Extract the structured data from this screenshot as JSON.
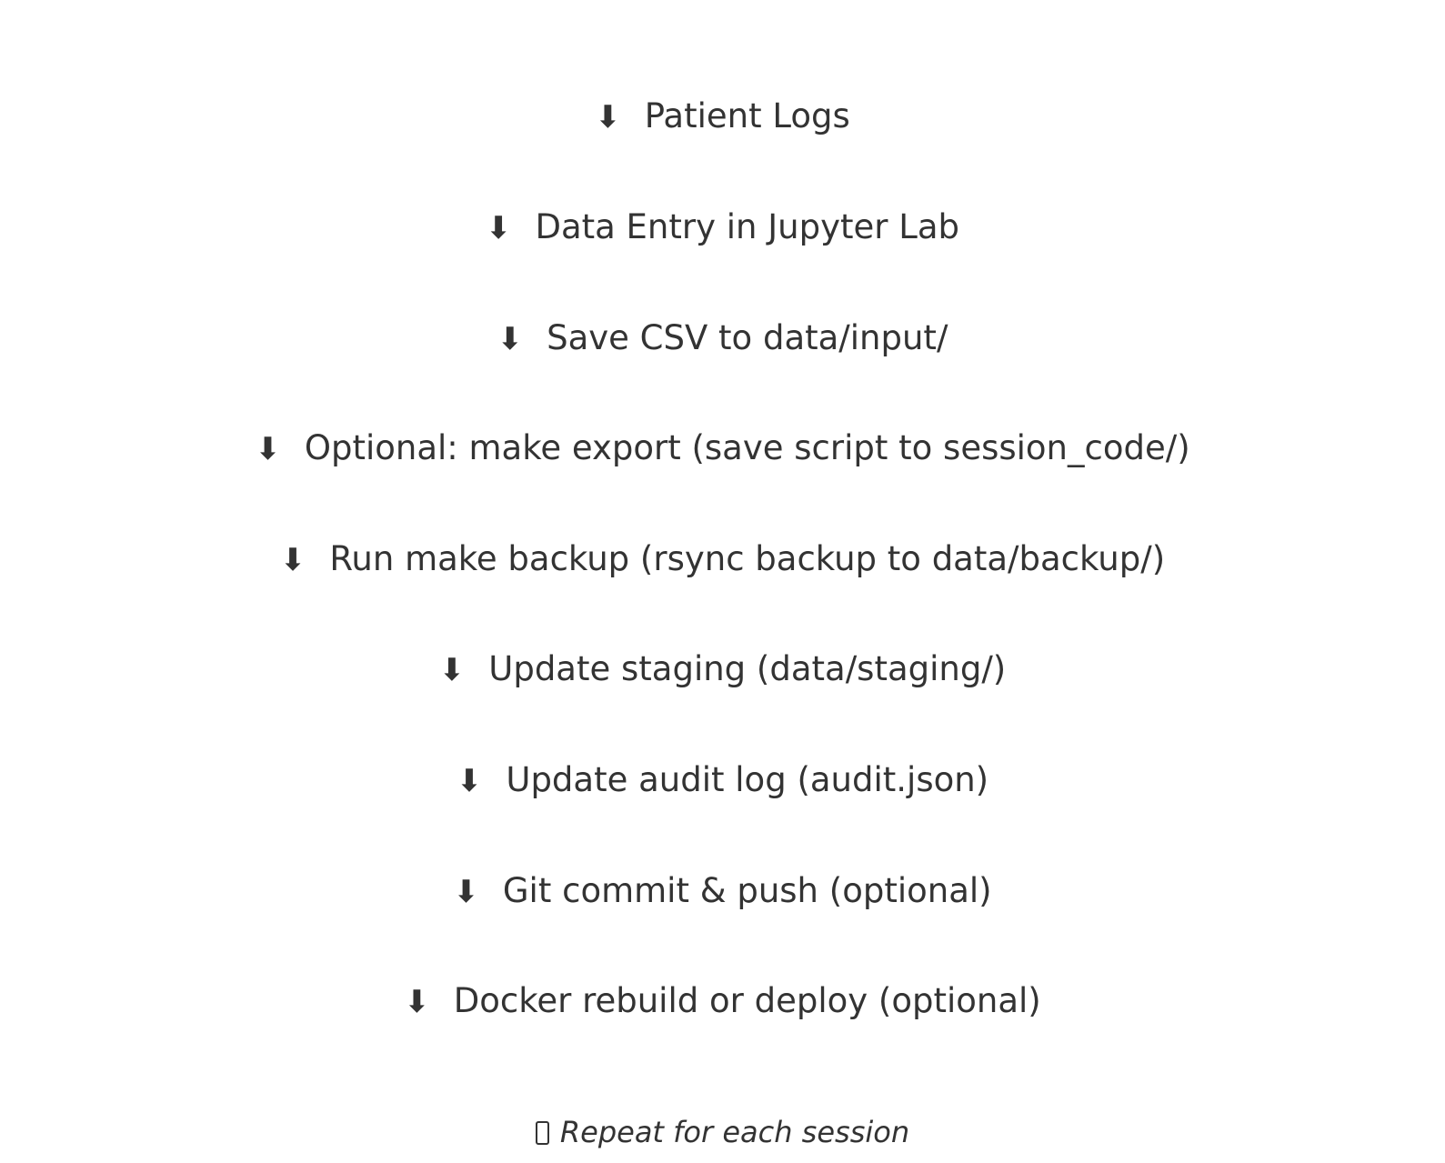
{
  "colors": {
    "text": "#333333",
    "background": "#ffffff"
  },
  "icons": {
    "step_arrow": "down-arrow-icon",
    "repeat": "repeat-icon"
  },
  "steps": [
    {
      "arrow": "⬇",
      "label": "Patient Logs"
    },
    {
      "arrow": "⬇",
      "label": "Data Entry in Jupyter Lab"
    },
    {
      "arrow": "⬇",
      "label": "Save CSV to data/input/"
    },
    {
      "arrow": "⬇",
      "label": "Optional: make export (save script to session_code/)"
    },
    {
      "arrow": "⬇",
      "label": "Run make backup (rsync backup to data/backup/)"
    },
    {
      "arrow": "⬇",
      "label": "Update staging (data/staging/)"
    },
    {
      "arrow": "⬇",
      "label": "Update audit log (audit.json)"
    },
    {
      "arrow": "⬇",
      "label": "Git commit & push (optional)"
    },
    {
      "arrow": "⬇",
      "label": "Docker rebuild or deploy (optional)"
    }
  ],
  "footer": {
    "label": "Repeat for each session"
  }
}
